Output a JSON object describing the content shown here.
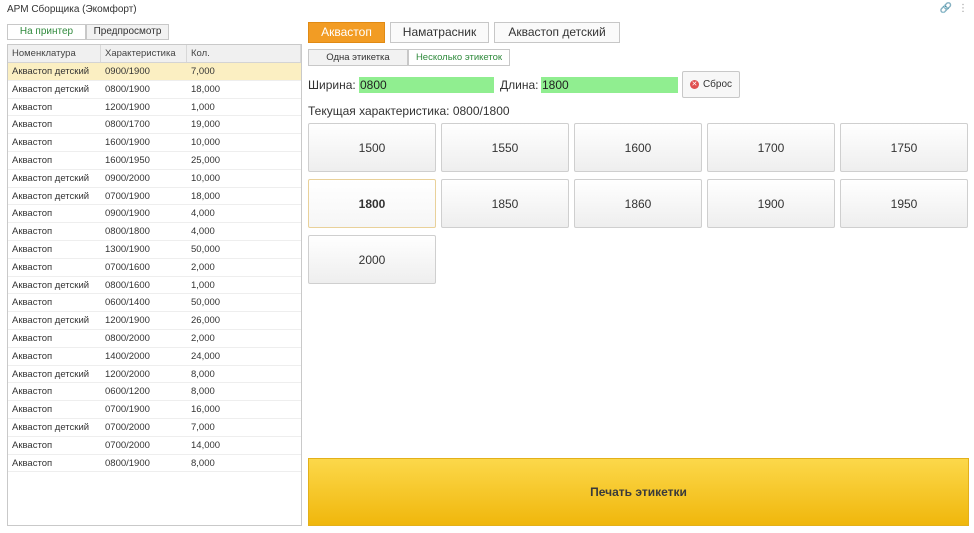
{
  "window": {
    "title": "АРМ Сборщика (Экомфорт)",
    "icons": {
      "link": "🔗",
      "more": "⋮"
    }
  },
  "left": {
    "print_target": {
      "printer": "На принтер",
      "preview": "Предпросмотр"
    },
    "table": {
      "columns": [
        "Номенклатура",
        "Характеристика",
        "Кол."
      ],
      "rows": [
        [
          "Аквастоп детский",
          "0900/1900",
          "7,000"
        ],
        [
          "Аквастоп детский",
          "0800/1900",
          "18,000"
        ],
        [
          "Аквастоп",
          "1200/1900",
          "1,000"
        ],
        [
          "Аквастоп",
          "0800/1700",
          "19,000"
        ],
        [
          "Аквастоп",
          "1600/1900",
          "10,000"
        ],
        [
          "Аквастоп",
          "1600/1950",
          "25,000"
        ],
        [
          "Аквастоп детский",
          "0900/2000",
          "10,000"
        ],
        [
          "Аквастоп детский",
          "0700/1900",
          "18,000"
        ],
        [
          "Аквастоп",
          "0900/1900",
          "4,000"
        ],
        [
          "Аквастоп",
          "0800/1800",
          "4,000"
        ],
        [
          "Аквастоп",
          "1300/1900",
          "50,000"
        ],
        [
          "Аквастоп",
          "0700/1600",
          "2,000"
        ],
        [
          "Аквастоп детский",
          "0800/1600",
          "1,000"
        ],
        [
          "Аквастоп",
          "0600/1400",
          "50,000"
        ],
        [
          "Аквастоп детский",
          "1200/1900",
          "26,000"
        ],
        [
          "Аквастоп",
          "0800/2000",
          "2,000"
        ],
        [
          "Аквастоп",
          "1400/2000",
          "24,000"
        ],
        [
          "Аквастоп детский",
          "1200/2000",
          "8,000"
        ],
        [
          "Аквастоп",
          "0600/1200",
          "8,000"
        ],
        [
          "Аквастоп",
          "0700/1900",
          "16,000"
        ],
        [
          "Аквастоп детский",
          "0700/2000",
          "7,000"
        ],
        [
          "Аквастоп",
          "0700/2000",
          "14,000"
        ],
        [
          "Аквастоп",
          "0800/1900",
          "8,000"
        ]
      ]
    }
  },
  "right": {
    "product_tabs": [
      "Аквастоп",
      "Наматрасник",
      "Аквастоп детский"
    ],
    "label_mode": {
      "single": "Одна этикетка",
      "multiple": "Несколько этикеток"
    },
    "width_label": "Ширина:",
    "width_value": "0800",
    "length_label": "Длина:",
    "length_value": "1800",
    "reset_label": "Сброс",
    "current_text": "Текущая характеристика: 0800/1800",
    "sizes": [
      "1500",
      "1550",
      "1600",
      "1700",
      "1750",
      "1800",
      "1850",
      "1860",
      "1900",
      "1950",
      "2000"
    ],
    "print_label": "Печать этикетки"
  },
  "colors": {
    "active_tab": "#f29c24",
    "green_field": "#90ee90",
    "print_button": "#f5c321",
    "selected_row": "#fbefc2",
    "active_text": "#2f8a3c"
  }
}
